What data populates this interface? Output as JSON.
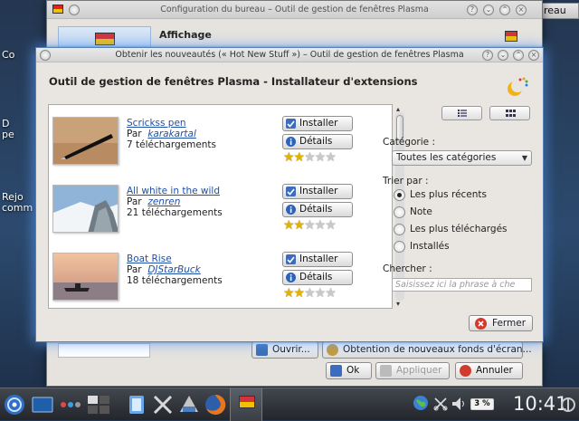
{
  "desktop": {
    "bureau_button": "bureau",
    "icon_label_1": "Co",
    "icon_label_2a": "D",
    "icon_label_2b": "pe",
    "icon_label_3a": "Rejo",
    "icon_label_3b": "comm"
  },
  "back_window": {
    "title": "Configuration du bureau – Outil de gestion de fenêtres Plasma",
    "section": "Affichage",
    "open_button": "Ouvrir...",
    "get_wallpapers_button": "Obtention de nouveaux fonds d'écran...",
    "ok_button": "Ok",
    "apply_button": "Appliquer",
    "cancel_button": "Annuler"
  },
  "dialog": {
    "title": "Obtenir les nouveautés (« Hot New Stuff ») – Outil de gestion de fenêtres Plasma",
    "header": "Outil de gestion de fenêtres Plasma - Installateur d'extensions",
    "install_label": "Installer",
    "details_label": "Détails",
    "by_label": "Par",
    "items": [
      {
        "title": "Scrickss pen",
        "author": "karakartal",
        "downloads": "7 téléchargements",
        "rating": 2
      },
      {
        "title": "All white in the wild",
        "author": "zenren",
        "downloads": "21 téléchargements",
        "rating": 2
      },
      {
        "title": "Boat Rise",
        "author": "DJStarBuck",
        "downloads": "18 téléchargements",
        "rating": 2
      }
    ],
    "category_label": "Catégorie :",
    "category_value": "Toutes les catégories",
    "sort_label": "Trier par :",
    "sort_options": [
      "Les plus récents",
      "Note",
      "Les plus téléchargés",
      "Installés"
    ],
    "search_label": "Chercher :",
    "search_placeholder": "Saisissez ici la phrase à che",
    "close_button": "Fermer"
  },
  "taskbar": {
    "battery": "3 %",
    "clock": "10:41"
  },
  "colors": {
    "link": "#1f4fa5",
    "star": "#e2b400",
    "glow": "#5aa0ff"
  }
}
